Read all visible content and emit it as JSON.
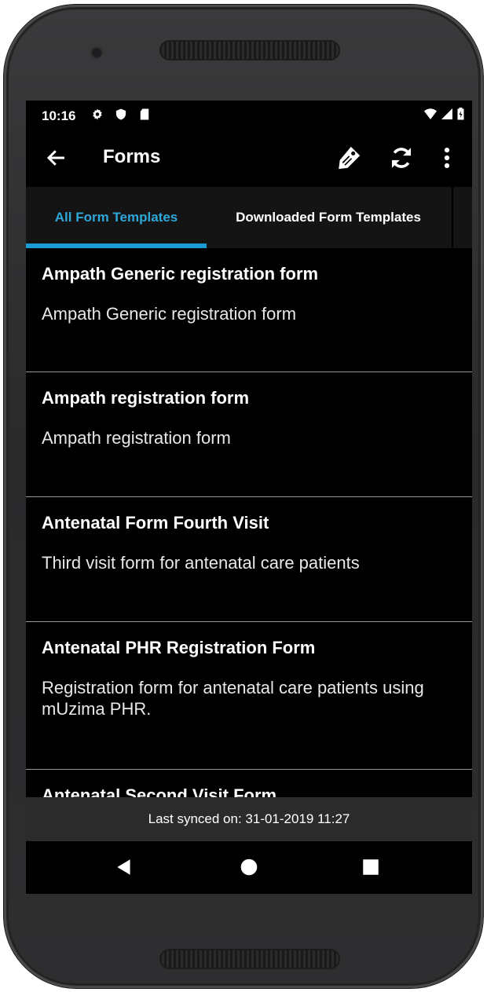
{
  "status": {
    "time": "10:16",
    "left_icons": [
      "gear-icon",
      "shield-icon",
      "sd-card-icon"
    ],
    "right_icons": [
      "wifi-icon",
      "signal-icon",
      "battery-icon"
    ]
  },
  "toolbar": {
    "title": "Forms",
    "actions": [
      "tag-icon",
      "sync-icon",
      "more-vert-icon"
    ]
  },
  "tabs": [
    {
      "label": "All Form Templates",
      "selected": true
    },
    {
      "label": "Downloaded Form Templates",
      "selected": false
    }
  ],
  "forms": [
    {
      "name": "Ampath Generic registration form",
      "description": "Ampath Generic registration form"
    },
    {
      "name": "Ampath registration form",
      "description": "Ampath registration form"
    },
    {
      "name": "Antenatal Form Fourth Visit",
      "description": "Third visit form for antenatal care patients"
    },
    {
      "name": "Antenatal PHR  Registration Form",
      "description": "Registration form for antenatal care patients using mUzima PHR."
    },
    {
      "name": "Antenatal Second Visit Form",
      "description": ""
    }
  ],
  "footer": {
    "sync_text": "Last synced on: 31-01-2019 11:27"
  },
  "colors": {
    "accent": "#1a9bd4",
    "tab_selected_text": "#2ea7d9",
    "background": "#000000",
    "tab_bar": "#141414",
    "footer": "#2b2b2b"
  }
}
